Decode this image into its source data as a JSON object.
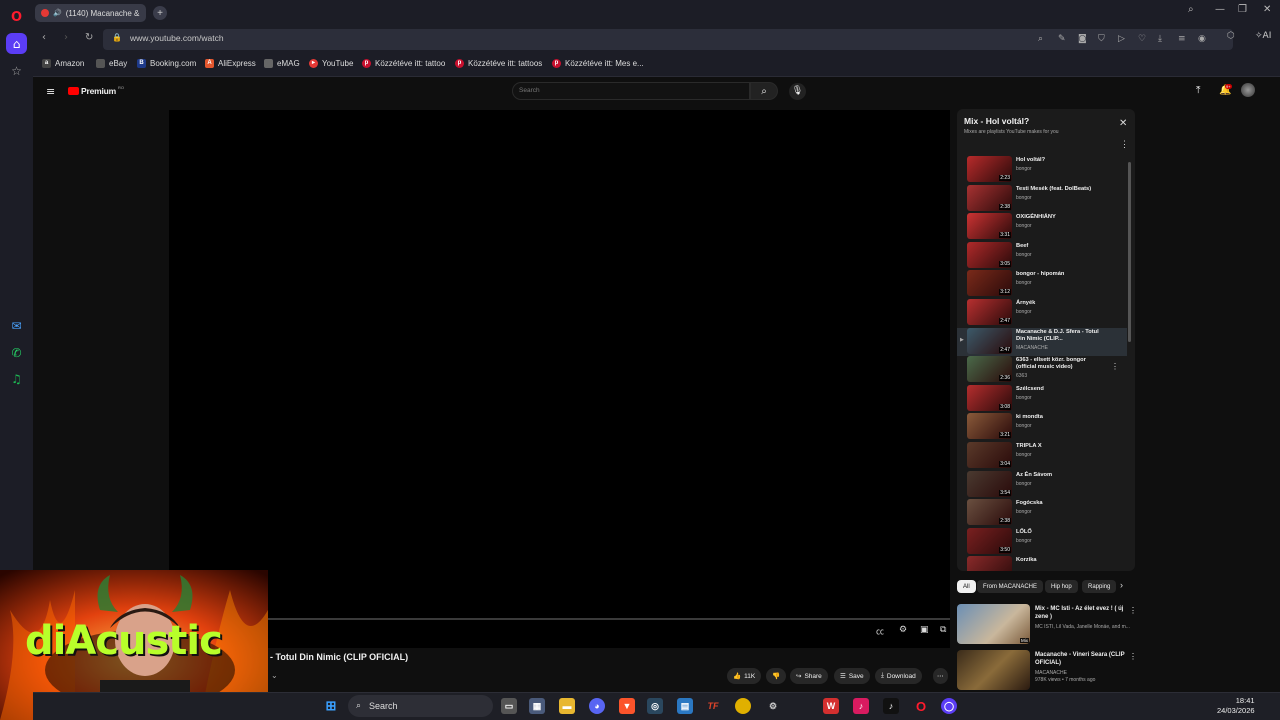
{
  "browser": {
    "tab": {
      "title": "(1140) Macanache & "
    },
    "url": "www.youtube.com/watch",
    "ai_label": "AI",
    "bookmarks": [
      {
        "label": "Amazon",
        "color": "#444"
      },
      {
        "label": "eBay",
        "color": "#555"
      },
      {
        "label": "Booking.com",
        "color": "#1e3a8a"
      },
      {
        "label": "AliExpress",
        "color": "#e4572e"
      },
      {
        "label": "eMAG",
        "color": "#666"
      },
      {
        "label": "YouTube",
        "color": "#e53935"
      },
      {
        "label": "Közzétéve itt: tattoo",
        "color": "#c8102e"
      },
      {
        "label": "Közzétéve itt: tattoos",
        "color": "#c8102e"
      },
      {
        "label": "Közzétéve itt: Mes e...",
        "color": "#c8102e"
      }
    ]
  },
  "youtube": {
    "logo": "Premium",
    "logo_sup": "RO",
    "notif_badge": "9+",
    "search_placeholder": "Search",
    "video_title": "- Totul Din Nimic (CLIP OFICIAL)",
    "actions": {
      "likes": "11K",
      "share": "Share",
      "save": "Save",
      "download": "Download"
    },
    "playlist": {
      "title": "Mix - Hol voltál?",
      "subtitle": "Mixes are playlists YouTube makes for you",
      "items": [
        {
          "title": "Hol voltál?",
          "channel": "bongor",
          "duration": "2:23"
        },
        {
          "title": "Testi Mesék (feat. DolBeats)",
          "channel": "bongor",
          "duration": "2:38"
        },
        {
          "title": "OXIGÉNHIÁNY",
          "channel": "bongor",
          "duration": "3:31"
        },
        {
          "title": "Beef",
          "channel": "bongor",
          "duration": "3:05"
        },
        {
          "title": "bongor - hipomán",
          "channel": "bongor",
          "duration": "3:12"
        },
        {
          "title": "Árnyék",
          "channel": "bongor",
          "duration": "2:47"
        },
        {
          "title": "Macanache & D.J. Sfera - Totul Din Nimic (CLIP...",
          "channel": "MACANACHE",
          "duration": "2:47"
        },
        {
          "title": "6363 - ellsett közr. bongor (official music video)",
          "channel": "6363",
          "duration": "2:36"
        },
        {
          "title": "Szélcsend",
          "channel": "bongor",
          "duration": "3:08"
        },
        {
          "title": "ki mondta",
          "channel": "bongor",
          "duration": "3:21"
        },
        {
          "title": "TRIPLA X",
          "channel": "bongor",
          "duration": "3:04"
        },
        {
          "title": "Az Én Sávom",
          "channel": "bongor",
          "duration": "3:54"
        },
        {
          "title": "Fogócska",
          "channel": "bongor",
          "duration": "2:38"
        },
        {
          "title": "LŐLŐ",
          "channel": "bongor",
          "duration": "3:50"
        },
        {
          "title": "Korzika",
          "channel": "",
          "duration": ""
        }
      ]
    },
    "chips": [
      "All",
      "From MACANACHE",
      "Hip hop",
      "Rapping"
    ],
    "recommendations": [
      {
        "title": "Mix - MC Isti - Az élet evez ! ( új zene )",
        "meta": "MC ISTI, Lil Vada, Janelle Monáe, and m...",
        "badge": "Mix"
      },
      {
        "title": "Macanache - Vineri Seara (CLIP OFICIAL)",
        "channel": "MACANACHE",
        "meta": "978K views • 7 months ago"
      }
    ]
  },
  "webcam": {
    "overlay_text": "diAcustic"
  },
  "taskbar": {
    "search": "Search",
    "time": "18:41",
    "date": "24/03/2026"
  }
}
